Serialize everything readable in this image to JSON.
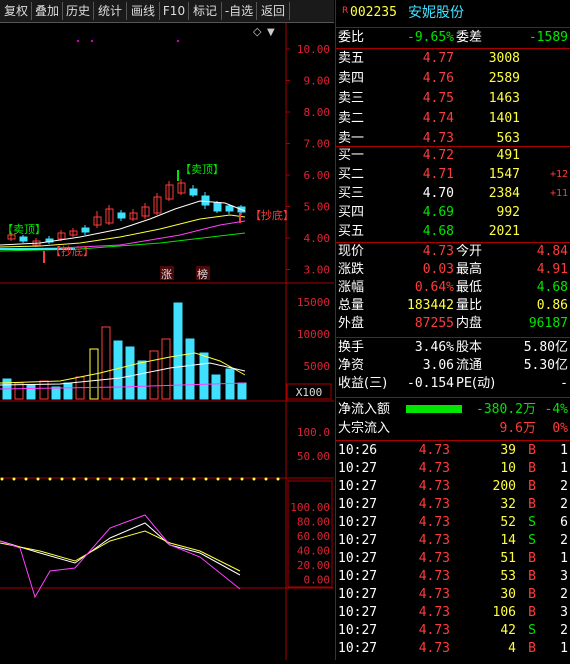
{
  "toolbar": {
    "buttons": [
      "复权",
      "叠加",
      "历史",
      "统计",
      "画线",
      "F10",
      "标记",
      "-自选",
      "返回"
    ]
  },
  "chart": {
    "price_axis": [
      "10.00",
      "9.00",
      "8.00",
      "7.00",
      "6.00",
      "5.00",
      "4.00",
      "3.00"
    ],
    "vol_axis": [
      "15000",
      "10000",
      "5000"
    ],
    "vol_unit": "X100",
    "ind1_axis": [
      "100.0",
      "50.00"
    ],
    "kdj_axis": [
      "100.00",
      "80.00",
      "60.00",
      "40.00",
      "20.00",
      "0.00"
    ],
    "sell_top_label": "【卖顶】",
    "sell_top_label2": "【卖顶】",
    "buy_bottom_label": "【抄底】",
    "buy_bottom_label2": "【抄底】",
    "badge1": "涨",
    "badge2": "榜",
    "diamond": "◇",
    "arrow": "▼"
  },
  "stock": {
    "code": "002235",
    "name": "安妮股份",
    "r_mark": "R"
  },
  "order_book": {
    "weibi_label": "委比",
    "weibi_value": "-9.65%",
    "weicha_label": "委差",
    "weicha_value": "-1589",
    "asks": [
      {
        "label": "卖五",
        "price": "4.77",
        "vol": "3008"
      },
      {
        "label": "卖四",
        "price": "4.76",
        "vol": "2589"
      },
      {
        "label": "卖三",
        "price": "4.75",
        "vol": "1463"
      },
      {
        "label": "卖二",
        "price": "4.74",
        "vol": "1401"
      },
      {
        "label": "卖一",
        "price": "4.73",
        "vol": "563"
      }
    ],
    "bids": [
      {
        "label": "买一",
        "price": "4.72",
        "vol": "491",
        "chg": ""
      },
      {
        "label": "买二",
        "price": "4.71",
        "vol": "1547",
        "chg": "+12"
      },
      {
        "label": "买三",
        "price": "4.70",
        "vol": "2384",
        "chg": "+11"
      },
      {
        "label": "买四",
        "price": "4.69",
        "vol": "992",
        "chg": ""
      },
      {
        "label": "买五",
        "price": "4.68",
        "vol": "2021",
        "chg": ""
      }
    ]
  },
  "quote": [
    {
      "l1": "现价",
      "v1": "4.73",
      "l2": "今开",
      "v2": "4.84"
    },
    {
      "l1": "涨跌",
      "v1": "0.03",
      "l2": "最高",
      "v2": "4.91"
    },
    {
      "l1": "涨幅",
      "v1": "0.64%",
      "l2": "最低",
      "v2": "4.68"
    },
    {
      "l1": "总量",
      "v1": "183442",
      "l2": "量比",
      "v2": "0.86"
    },
    {
      "l1": "外盘",
      "v1": "87255",
      "l2": "内盘",
      "v2": "96187"
    }
  ],
  "fundamentals": [
    {
      "l1": "换手",
      "v1": "3.46%",
      "l2": "股本",
      "v2": "5.80亿"
    },
    {
      "l1": "净资",
      "v1": "3.06",
      "l2": "流通",
      "v2": "5.30亿"
    },
    {
      "l1": "收益(三)",
      "v1": "-0.154",
      "l2": "PE(动)",
      "v2": "-"
    }
  ],
  "flow": {
    "net_label": "净流入额",
    "net_value": "-380.2万",
    "net_pct": "-4%",
    "big_label": "大宗流入",
    "big_value": "9.6万",
    "big_pct": "0%"
  },
  "ticks": [
    {
      "t": "10:26",
      "p": "4.73",
      "v": "39",
      "s": "B",
      "n": "1"
    },
    {
      "t": "10:27",
      "p": "4.73",
      "v": "10",
      "s": "B",
      "n": "1"
    },
    {
      "t": "10:27",
      "p": "4.73",
      "v": "200",
      "s": "B",
      "n": "2"
    },
    {
      "t": "10:27",
      "p": "4.73",
      "v": "32",
      "s": "B",
      "n": "2"
    },
    {
      "t": "10:27",
      "p": "4.73",
      "v": "52",
      "s": "S",
      "n": "6"
    },
    {
      "t": "10:27",
      "p": "4.73",
      "v": "14",
      "s": "S",
      "n": "2"
    },
    {
      "t": "10:27",
      "p": "4.73",
      "v": "51",
      "s": "B",
      "n": "1"
    },
    {
      "t": "10:27",
      "p": "4.73",
      "v": "53",
      "s": "B",
      "n": "3"
    },
    {
      "t": "10:27",
      "p": "4.73",
      "v": "30",
      "s": "B",
      "n": "2"
    },
    {
      "t": "10:27",
      "p": "4.73",
      "v": "106",
      "s": "B",
      "n": "3"
    },
    {
      "t": "10:27",
      "p": "4.73",
      "v": "42",
      "s": "S",
      "n": "2"
    },
    {
      "t": "10:27",
      "p": "4.73",
      "v": "4",
      "s": "B",
      "n": "1"
    }
  ]
}
